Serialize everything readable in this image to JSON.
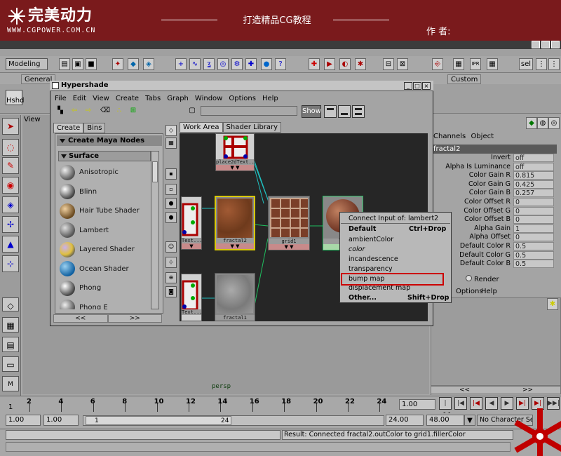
{
  "banner": {
    "logo_text": "完美动力",
    "url": "WWW.CGPOWER.COM.CN",
    "slogan": "打造精品CG教程",
    "author_label": "作 者:"
  },
  "maya": {
    "mode": "Modeling",
    "shelf_tabs": [
      "General",
      "Custom"
    ],
    "shelf_button": "Hshd",
    "viewport_menu": "View",
    "viewport_camera": "persp",
    "colors": {
      "accent_red": "#7a1a1c",
      "selection_red": "#cc0000"
    }
  },
  "hypershade": {
    "title": "Hypershade",
    "menus": [
      "File",
      "Edit",
      "View",
      "Create",
      "Tabs",
      "Graph",
      "Window",
      "Options",
      "Help"
    ],
    "show_label": "Show",
    "create_tabs": [
      "Create",
      "Bins"
    ],
    "create_header": "Create Maya Nodes",
    "surface_header": "Surface",
    "materials": [
      "Anisotropic",
      "Blinn",
      "Hair Tube Shader",
      "Lambert",
      "Layered Shader",
      "Ocean Shader",
      "Phong",
      "Phong E"
    ],
    "page_prev": "<<",
    "page_next": ">>",
    "work_tabs": [
      "Work Area",
      "Shader Library"
    ],
    "nodes": {
      "place2d": "place2dText...",
      "tex1": "Text...",
      "fractal2": "fractal2",
      "grid1": "grid1",
      "lambert": "lam",
      "tex2": "Text...",
      "fractal1": "fractal1"
    }
  },
  "context_menu": {
    "title": "Connect Input of: lambert2",
    "items": [
      {
        "label": "Default",
        "shortcut": "Ctrl+Drop"
      },
      {
        "label": "ambientColor",
        "shortcut": ""
      },
      {
        "label": "color",
        "shortcut": ""
      },
      {
        "label": "incandescence",
        "shortcut": ""
      },
      {
        "label": "transparency",
        "shortcut": ""
      },
      {
        "label": "bump map",
        "shortcut": ""
      },
      {
        "label": "displacement map",
        "shortcut": ""
      },
      {
        "label": "Other...",
        "shortcut": "Shift+Drop"
      }
    ]
  },
  "attribute_editor": {
    "tabs": [
      "Channels",
      "Object"
    ],
    "node_name": "fractal2",
    "attributes": [
      {
        "name": "Invert",
        "value": "off"
      },
      {
        "name": "Alpha Is Luminance",
        "value": "off"
      },
      {
        "name": "Color Gain R",
        "value": "0.815"
      },
      {
        "name": "Color Gain G",
        "value": "0.425"
      },
      {
        "name": "Color Gain B",
        "value": "0.257"
      },
      {
        "name": "Color Offset R",
        "value": "0"
      },
      {
        "name": "Color Offset G",
        "value": "0"
      },
      {
        "name": "Color Offset B",
        "value": "0"
      },
      {
        "name": "Alpha Gain",
        "value": "1"
      },
      {
        "name": "Alpha Offset",
        "value": "0"
      },
      {
        "name": "Default Color R",
        "value": "0.5"
      },
      {
        "name": "Default Color G",
        "value": "0.5"
      },
      {
        "name": "Default Color B",
        "value": "0.5"
      }
    ],
    "layer_tabs": [
      "play",
      "Render"
    ],
    "layer_menus": [
      "Options",
      "Help"
    ],
    "nav_prev": "<<",
    "nav_next": ">>"
  },
  "timeline": {
    "ticks": [
      "2",
      "4",
      "6",
      "8",
      "10",
      "12",
      "14",
      "16",
      "18",
      "20",
      "22",
      "24"
    ],
    "first_frame": "1",
    "current_frame": "1.00",
    "range_start": "1.00",
    "range_start_inner": "1.00",
    "slider_start": "1",
    "slider_end": "24",
    "range_end": "24.00",
    "range_end_outer": "48.00",
    "character_set": "No Character Set"
  },
  "status": {
    "result": "Result: Connected fractal2.outColor to grid1.fillerColor"
  }
}
